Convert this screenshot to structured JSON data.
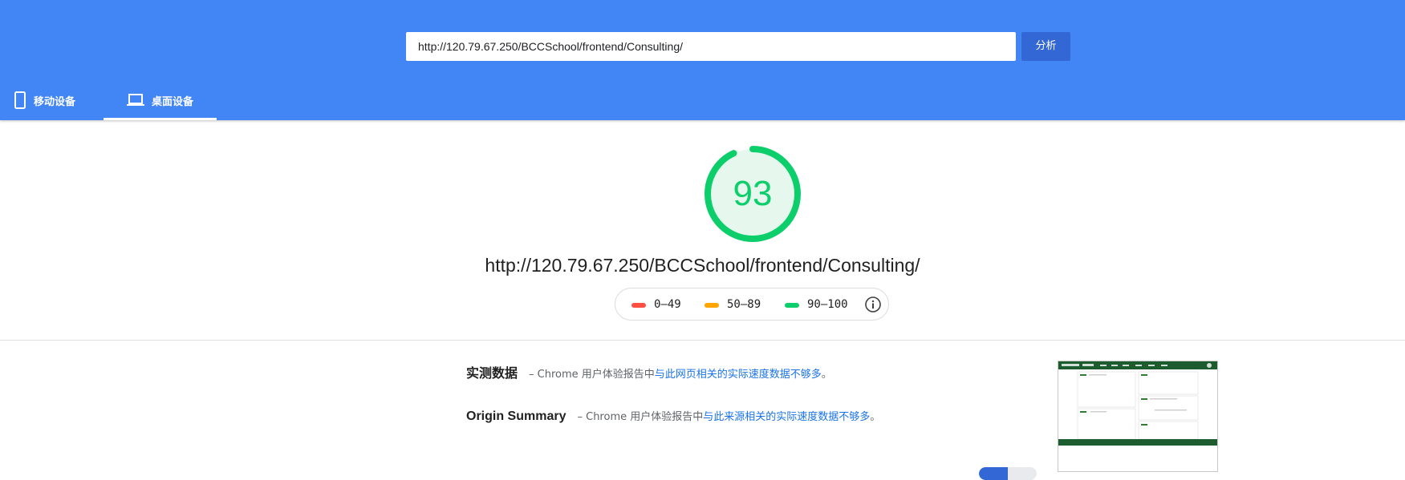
{
  "header": {
    "url_value": "http://120.79.67.250/BCCSchool/frontend/Consulting/",
    "analyze_label": "分析",
    "tabs": [
      {
        "label": "移动设备",
        "icon": "mobile-phone-icon",
        "selected": false
      },
      {
        "label": "桌面设备",
        "icon": "laptop-icon",
        "selected": true
      }
    ]
  },
  "score": {
    "value": "93",
    "fraction": 0.93,
    "url": "http://120.79.67.250/BCCSchool/frontend/Consulting/",
    "color": "#0cce6b",
    "fill_color": "#e6f8ee"
  },
  "legend": {
    "ranges": [
      {
        "label": "0–49",
        "color": "#ff4e42"
      },
      {
        "label": "50–89",
        "color": "#ffa400"
      },
      {
        "label": "90–100",
        "color": "#0cce6b"
      }
    ],
    "info_icon": "info-icon"
  },
  "field_data": {
    "title": "实测数据",
    "desc_prefix": "– Chrome 用户体验报告中",
    "link": "与此网页相关的实际速度数据不够多",
    "suffix": "。"
  },
  "origin_summary": {
    "title": "Origin Summary",
    "desc_prefix": "– Chrome 用户体验报告中",
    "link": "与此来源相关的实际速度数据不够多",
    "suffix": "。"
  },
  "colors": {
    "header_bg": "#4285f4",
    "button_bg": "#3367d6",
    "link": "#1a73e8",
    "thumbnail_nav": "#1c5c2e"
  }
}
